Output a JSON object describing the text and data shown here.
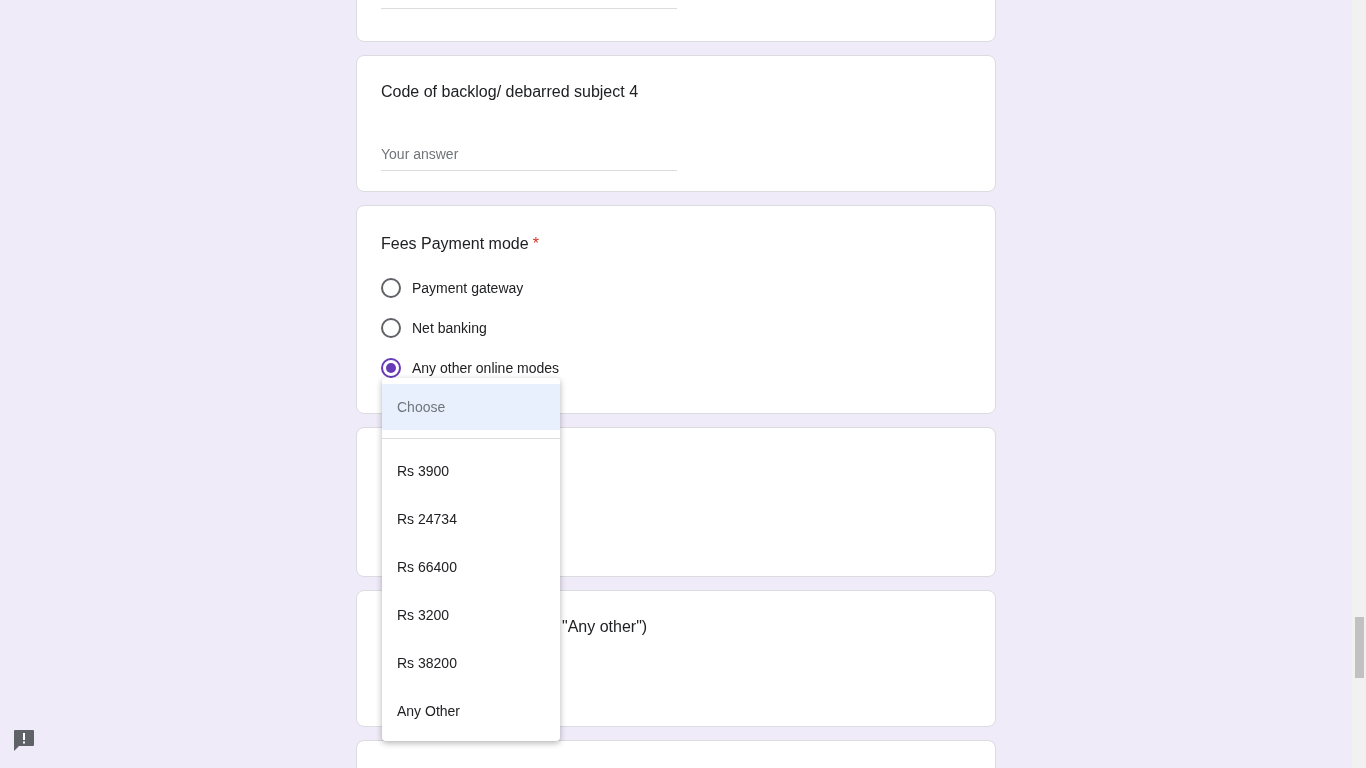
{
  "questions": [
    {
      "kind": "text",
      "title": "Code of backlog/ debarred subject 4",
      "placeholder": "Your answer"
    },
    {
      "kind": "radio",
      "title": "Fees Payment mode",
      "required_mark": "*",
      "options": [
        {
          "label": "Payment gateway",
          "selected": false
        },
        {
          "label": "Net banking",
          "selected": false
        },
        {
          "label": "Any other online modes",
          "selected": true
        }
      ]
    },
    {
      "kind": "select"
    },
    {
      "kind": "partial",
      "title": "\"Any other\")"
    }
  ],
  "dropdown": {
    "options": [
      {
        "label": "Choose",
        "selected": true
      },
      {
        "label": "Rs 3900",
        "selected": false
      },
      {
        "label": "Rs 24734",
        "selected": false
      },
      {
        "label": "Rs 66400",
        "selected": false
      },
      {
        "label": "Rs 3200",
        "selected": false
      },
      {
        "label": "Rs 38200",
        "selected": false
      },
      {
        "label": "Any Other",
        "selected": false
      }
    ]
  }
}
